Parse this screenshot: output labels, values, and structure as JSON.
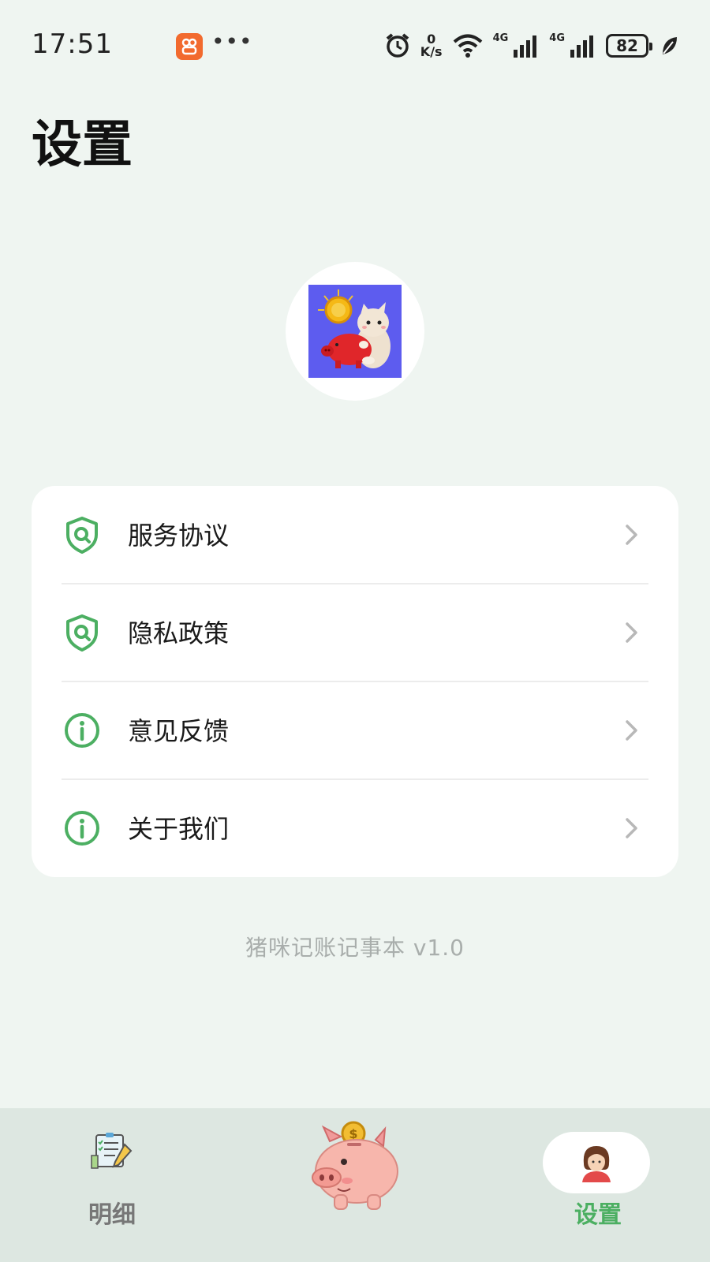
{
  "status_bar": {
    "time": "17:51",
    "net_speed_value": "0",
    "net_speed_unit": "K/s",
    "signal1_label": "4G",
    "signal2_label": "4G",
    "battery": "82",
    "icons": [
      "app-notification-icon",
      "more-icon",
      "alarm-icon",
      "wifi-icon",
      "signal-icon",
      "battery-icon",
      "leaf-icon"
    ]
  },
  "header": {
    "title": "设置"
  },
  "settings": {
    "items": [
      {
        "label": "服务协议",
        "icon": "shield-search-icon"
      },
      {
        "label": "隐私政策",
        "icon": "shield-search-icon"
      },
      {
        "label": "意见反馈",
        "icon": "info-icon"
      },
      {
        "label": "关于我们",
        "icon": "info-icon"
      }
    ]
  },
  "footer": {
    "version": "猪咪记账记事本 v1.0"
  },
  "bottom_nav": {
    "items": [
      {
        "label": "明细",
        "icon": "checklist-icon"
      },
      {
        "label": "",
        "icon": "piggy-bank-icon"
      },
      {
        "label": "设置",
        "icon": "person-icon",
        "active": true
      }
    ]
  },
  "colors": {
    "accent": "#4caf62",
    "background": "#eff5f1",
    "logo_bg": "#5d5cef"
  }
}
